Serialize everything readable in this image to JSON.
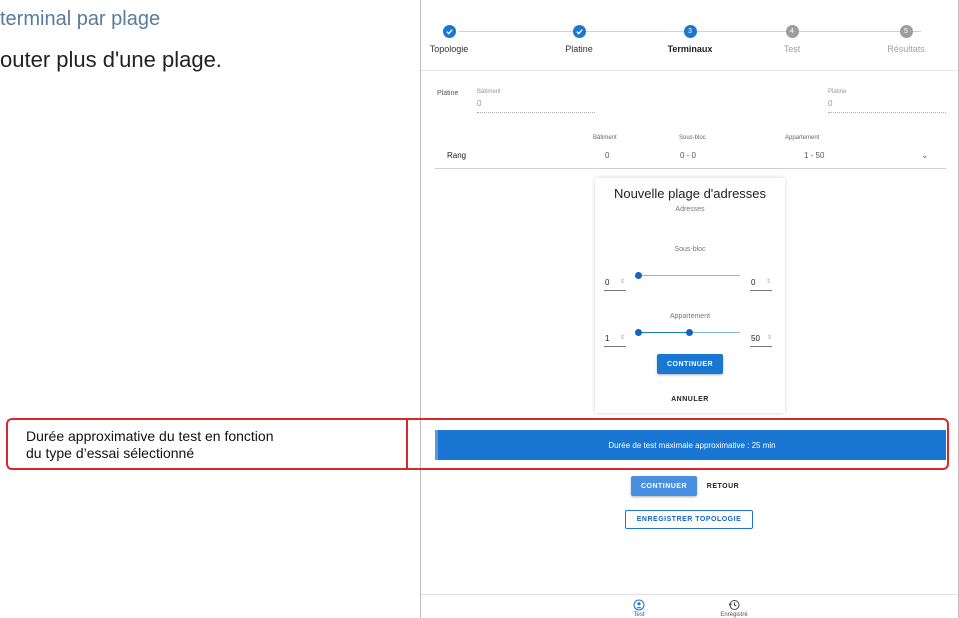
{
  "doc": {
    "subtitle": "terminal par plage",
    "line": "outer plus d'une plage."
  },
  "stepper": {
    "steps": [
      {
        "label": "Topologie",
        "state": "done",
        "number": ""
      },
      {
        "label": "Platine",
        "state": "done",
        "number": ""
      },
      {
        "label": "Terminaux",
        "state": "active",
        "number": "3"
      },
      {
        "label": "Test",
        "state": "todo",
        "number": "4"
      },
      {
        "label": "Résultats",
        "state": "todo",
        "number": "5"
      }
    ]
  },
  "platine": {
    "label": "Platine",
    "left_field": {
      "label": "Bâtiment",
      "value": "0"
    },
    "right_field": {
      "label": "Platine",
      "value": "0"
    }
  },
  "rang": {
    "headers": {
      "batiment": "Bâtiment",
      "sous_bloc": "Sous-bloc",
      "appartement": "Appartement"
    },
    "label": "Rang",
    "batiment": "0",
    "sous_bloc": "0 - 0",
    "appartement": "1 - 50"
  },
  "card": {
    "title": "Nouvelle plage d'adresses",
    "subtitle": "Adresses",
    "sous_bloc": {
      "label": "Sous-bloc",
      "min": "0",
      "max": "0",
      "low_fraction": 0,
      "high_fraction": 0
    },
    "appartement": {
      "label": "Appartement",
      "min": "1",
      "max": "50",
      "low_fraction": 0,
      "high_fraction": 0.5
    },
    "continue_label": "CONTINUER",
    "cancel_label": "ANNULER"
  },
  "banner": {
    "text": "Durée de test maximale approximative : 25 min"
  },
  "actions": {
    "continue_label": "CONTINUER",
    "back_label": "RETOUR",
    "save_topology_label": "ENREGISTRER TOPOLOGIE"
  },
  "bottom_nav": {
    "items": [
      {
        "label": "Test",
        "icon": "user-circle-icon"
      },
      {
        "label": "Enregistré",
        "icon": "history-icon"
      }
    ]
  },
  "callout": {
    "line1": "Durée approximative du test en fonction",
    "line2": "du type d’essai sélectionné"
  },
  "colors": {
    "primary": "#1976d2",
    "annotation": "#d9272e"
  }
}
